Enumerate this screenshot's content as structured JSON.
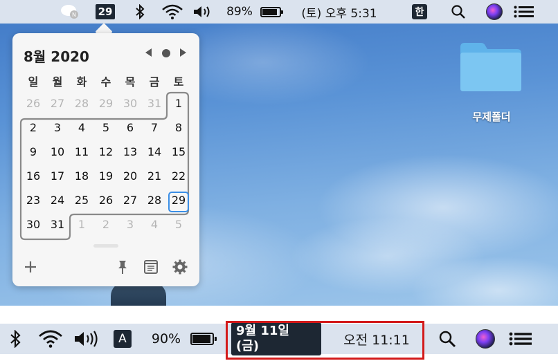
{
  "top_menubar": {
    "notification_icon_badge": "N",
    "date_badge": "29",
    "battery_percent": "89%",
    "clock": "(토) 오후 5:31",
    "input_method": "한"
  },
  "calendar": {
    "title": "8월 2020",
    "weekdays": [
      "일",
      "월",
      "화",
      "수",
      "목",
      "금",
      "토"
    ],
    "weeks": [
      [
        "26",
        "27",
        "28",
        "29",
        "30",
        "31",
        "1"
      ],
      [
        "2",
        "3",
        "4",
        "5",
        "6",
        "7",
        "8"
      ],
      [
        "9",
        "10",
        "11",
        "12",
        "13",
        "14",
        "15"
      ],
      [
        "16",
        "17",
        "18",
        "19",
        "20",
        "21",
        "22"
      ],
      [
        "23",
        "24",
        "25",
        "26",
        "27",
        "28",
        "29"
      ],
      [
        "30",
        "31",
        "1",
        "2",
        "3",
        "4",
        "5"
      ]
    ],
    "today": "29"
  },
  "desktop": {
    "folder_label": "무제폴더"
  },
  "bottom_menubar": {
    "input_method": "A",
    "battery_percent": "90%",
    "date_badge": "9월 11일 (금)",
    "clock": "오전 11:11"
  },
  "colors": {
    "menubar_bg": "#dbe3ee",
    "badge_bg": "#1d2733",
    "today_outline": "#3a8ee6",
    "highlight": "#d31a1a"
  }
}
